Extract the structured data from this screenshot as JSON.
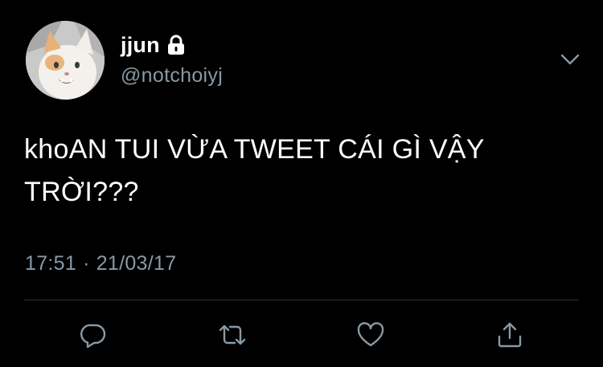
{
  "user": {
    "display_name": "jjun",
    "handle": "@notchoiyj",
    "avatar_icon": "cat-avatar",
    "protected_icon": "lock-icon"
  },
  "tweet": {
    "text": "khoAN TUI VỪA TWEET CÁI GÌ VẬY TRỜI???",
    "time": "17:51",
    "separator": "·",
    "date": "21/03/17"
  },
  "actions": [
    {
      "name": "reply",
      "icon": "reply-icon"
    },
    {
      "name": "retweet",
      "icon": "retweet-icon"
    },
    {
      "name": "like",
      "icon": "heart-icon"
    },
    {
      "name": "share",
      "icon": "share-icon"
    }
  ],
  "colors": {
    "background": "#000000",
    "primary_text": "#ffffff",
    "secondary_text": "#8899a6",
    "divider": "#2f3336"
  }
}
